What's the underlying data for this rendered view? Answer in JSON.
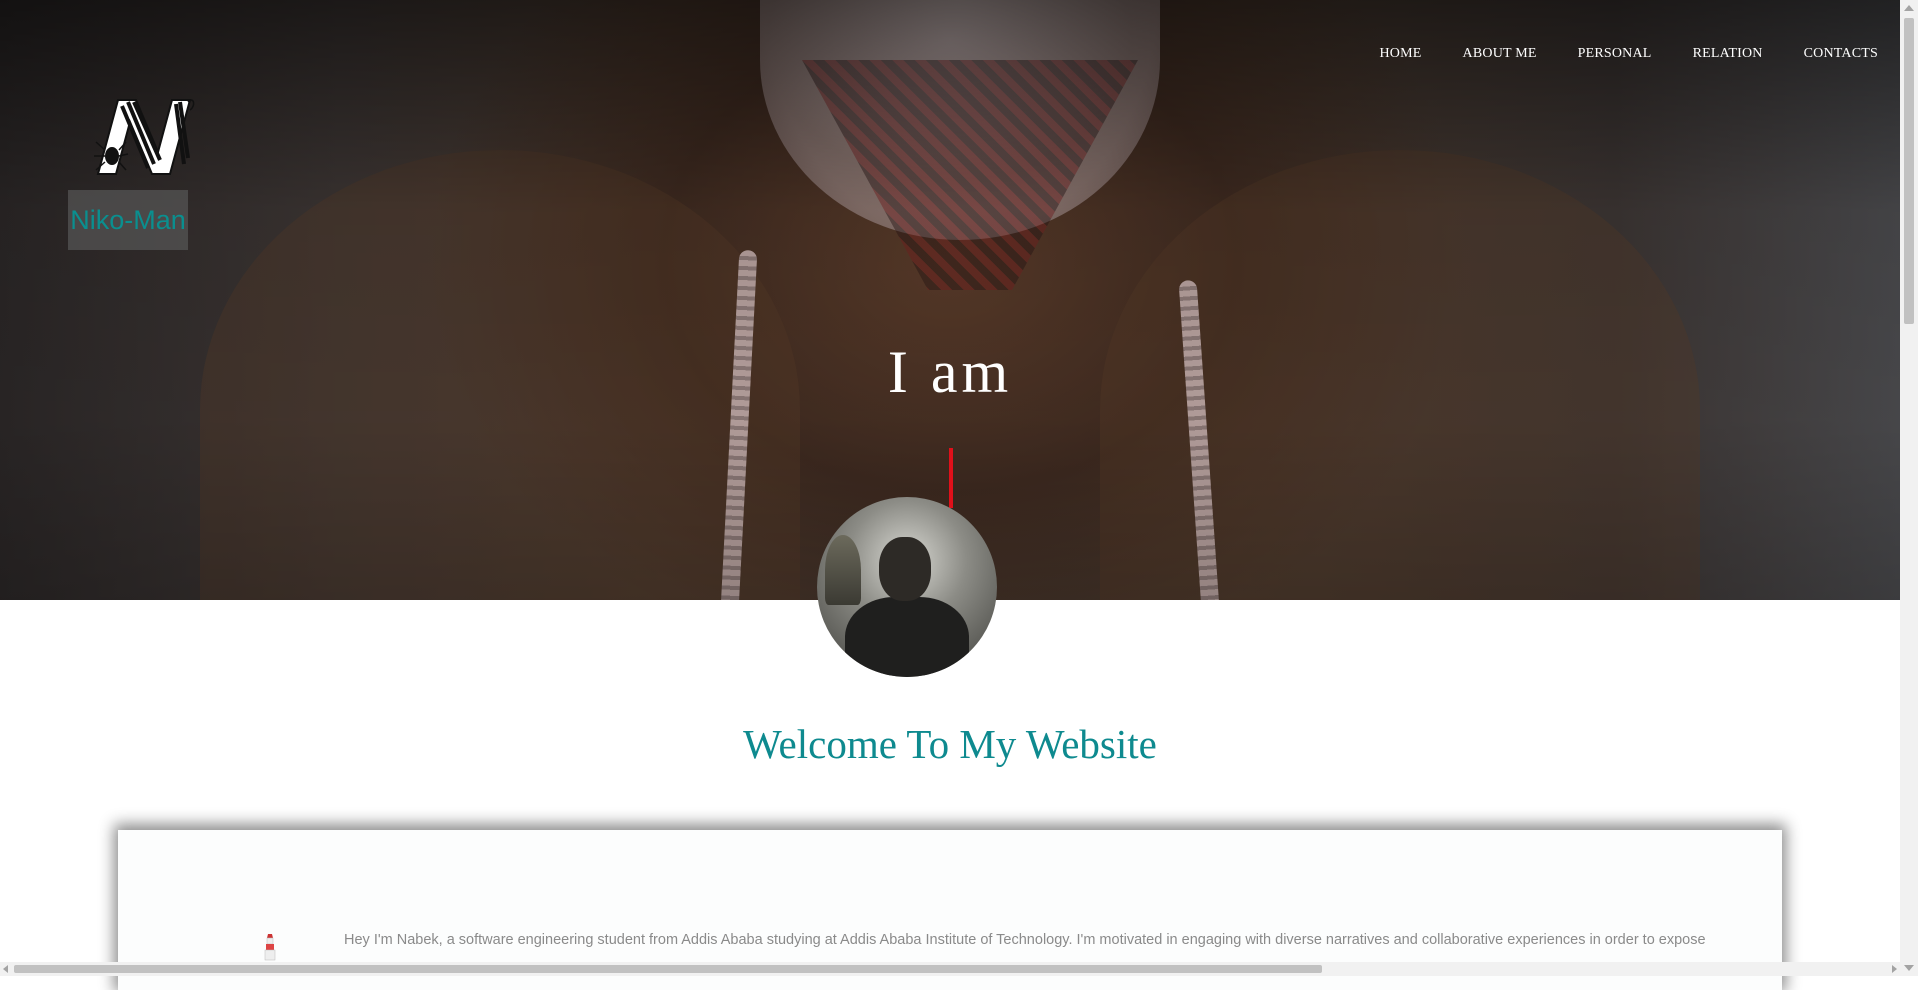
{
  "nav": {
    "items": [
      {
        "label": "HOME"
      },
      {
        "label": "ABOUT ME"
      },
      {
        "label": "PERSONAL"
      },
      {
        "label": "RELATION"
      },
      {
        "label": "CONTACTS"
      }
    ]
  },
  "brand": {
    "logo_icon": "n-spider-logo-icon",
    "name": "Niko-Man"
  },
  "hero": {
    "headline": "I am",
    "cursor_color": "#e0101a"
  },
  "profile": {
    "avatar": "profile-photo"
  },
  "welcome": {
    "title": "Welcome To My Website",
    "color": "#0e8a8f"
  },
  "about": {
    "icon": "lighthouse-icon",
    "text": "Hey I'm Nabek, a software engineering student from Addis Ababa studying at Addis Ababa Institute of Technology. I'm motivated in engaging with diverse narratives and collaborative experiences in order to expose"
  }
}
